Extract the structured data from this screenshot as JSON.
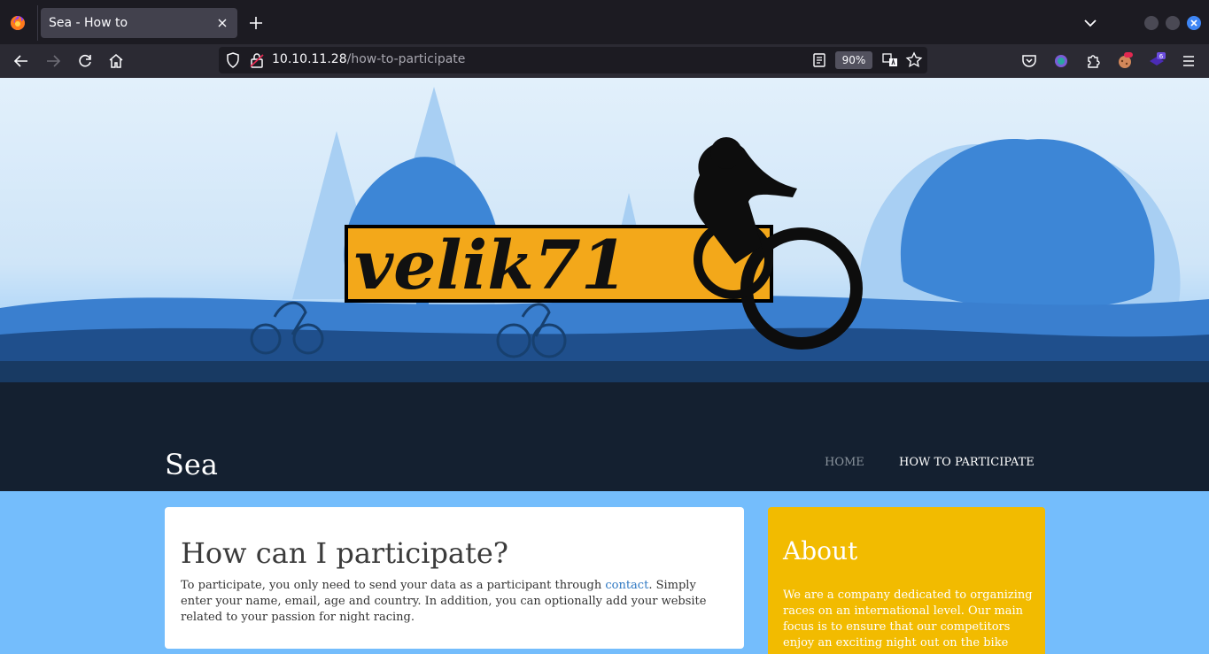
{
  "browser": {
    "tab_title": "Sea - How to",
    "url_host": "10.10.11.28",
    "url_path": "/how-to-participate",
    "zoom": "90%",
    "extension_badge": "6"
  },
  "site": {
    "logo_text": "velik71",
    "title": "Sea",
    "nav": {
      "home": "HOME",
      "how_to": "HOW TO PARTICIPATE"
    }
  },
  "main": {
    "heading": "How can I participate?",
    "text_before": "To participate, you only need to send your data as a participant through ",
    "link_text": "contact",
    "text_after": ". Simply enter your name, email, age and country. In addition, you can optionally add your website related to your passion for night racing."
  },
  "about": {
    "heading": "About",
    "text": "We are a company dedicated to organizing races on an international level. Our main focus is to ensure that our competitors enjoy an exciting night out on the bike"
  },
  "colors": {
    "accent_yellow": "#f2bb00",
    "page_blue": "#74bdfc",
    "header_dark": "#142030",
    "link_blue": "#2d77c2"
  }
}
